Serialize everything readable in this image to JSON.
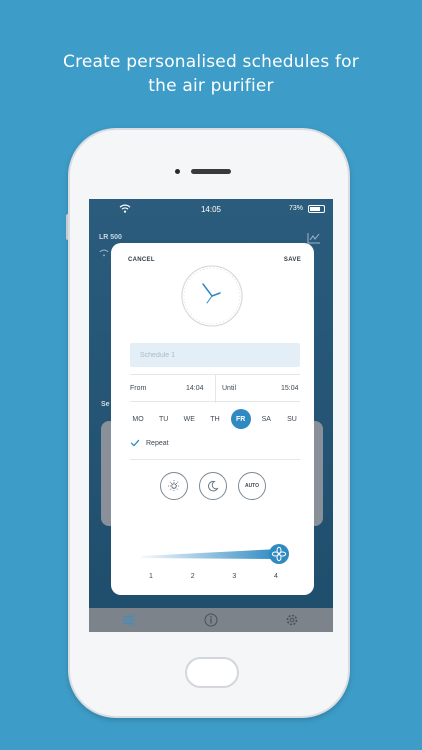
{
  "headline": {
    "line1": "Create personalised schedules for",
    "line2": "the air purifier"
  },
  "status_bar": {
    "time": "14:05",
    "battery": "73%"
  },
  "background_screen": {
    "device_name": "LR 500",
    "section_label": "Se"
  },
  "modal": {
    "cancel_label": "CANCEL",
    "save_label": "SAVE",
    "schedule_name_placeholder": "Schedule 1",
    "from_label": "From",
    "from_value": "14:04",
    "until_label": "Until",
    "until_value": "15:04",
    "days": [
      {
        "label": "MO",
        "selected": false
      },
      {
        "label": "TU",
        "selected": false
      },
      {
        "label": "WE",
        "selected": false
      },
      {
        "label": "TH",
        "selected": false
      },
      {
        "label": "FR",
        "selected": true
      },
      {
        "label": "SA",
        "selected": false
      },
      {
        "label": "SU",
        "selected": false
      }
    ],
    "repeat_label": "Repeat",
    "repeat_checked": true,
    "modes": [
      {
        "icon": "sun-icon"
      },
      {
        "icon": "moon-icon"
      },
      {
        "label": "AUTO"
      }
    ],
    "fan_speed_ticks": [
      "1",
      "2",
      "3",
      "4"
    ],
    "fan_speed_value": 4
  },
  "tab_bar": {
    "items": [
      "fan-icon",
      "info-icon",
      "gear-icon"
    ]
  },
  "colors": {
    "background": "#3d9dc8",
    "accent": "#2f8ac1",
    "input_fill": "#e3eef6"
  }
}
